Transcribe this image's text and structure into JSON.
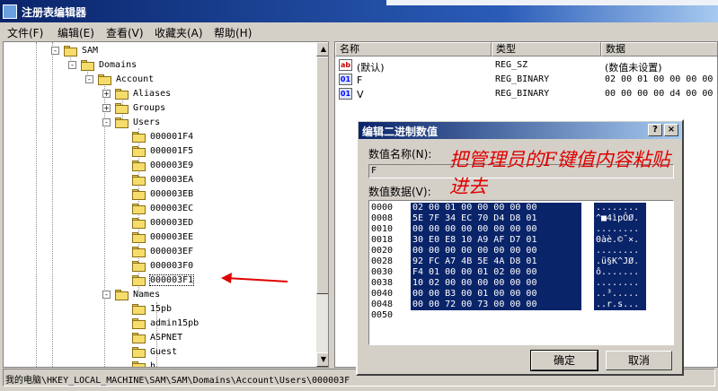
{
  "window": {
    "title": "注册表编辑器"
  },
  "menu": [
    {
      "label": "文件(F)"
    },
    {
      "label": "编辑(E)"
    },
    {
      "label": "查看(V)"
    },
    {
      "label": "收藏夹(A)"
    },
    {
      "label": "帮助(H)"
    }
  ],
  "tree": {
    "nodes": [
      {
        "label": "SAM",
        "expander": "-"
      },
      {
        "label": "Domains",
        "expander": "-"
      },
      {
        "label": "Account",
        "expander": "-"
      },
      {
        "label": "Aliases",
        "expander": "+"
      },
      {
        "label": "Groups",
        "expander": "+"
      },
      {
        "label": "Users",
        "expander": "-"
      },
      {
        "label": "000001F4"
      },
      {
        "label": "000001F5"
      },
      {
        "label": "000003E9"
      },
      {
        "label": "000003EA"
      },
      {
        "label": "000003EB"
      },
      {
        "label": "000003EC"
      },
      {
        "label": "000003ED"
      },
      {
        "label": "000003EE"
      },
      {
        "label": "000003EF"
      },
      {
        "label": "000003F0"
      },
      {
        "label": "000003F1",
        "selected": true
      },
      {
        "label": "Names",
        "expander": "-"
      },
      {
        "label": "15pb"
      },
      {
        "label": "admin15pb"
      },
      {
        "label": "ASPNET"
      },
      {
        "label": "Guest"
      },
      {
        "label": "h..."
      }
    ]
  },
  "list": {
    "columns": [
      "名称",
      "类型",
      "数据"
    ],
    "rows": [
      {
        "icon": "ab",
        "name": "(默认)",
        "type": "REG_SZ",
        "data": "(数值未设置)"
      },
      {
        "icon": "bin",
        "name": "F",
        "type": "REG_BINARY",
        "data": "02 00 01 00 00 00 00 00 5"
      },
      {
        "icon": "bin",
        "name": "V",
        "type": "REG_BINARY",
        "data": "00 00 00 00 d4 00 00 00 0"
      }
    ]
  },
  "statusbar": {
    "path": "我的电脑\\HKEY_LOCAL_MACHINE\\SAM\\SAM\\Domains\\Account\\Users\\000003F"
  },
  "dialog": {
    "title": "编辑二进制数值",
    "help_btn": "?",
    "close_btn": "×",
    "name_label": "数值名称(N):",
    "name_value": "F",
    "data_label": "数值数据(V):",
    "hex_rows": [
      {
        "offset": "0000",
        "bytes": "02 00 01 00 00 00 00 00",
        "ascii": "........"
      },
      {
        "offset": "0008",
        "bytes": "5E 7F 34 EC 70 D4 D8 01",
        "ascii": "^■4ìpÔØ."
      },
      {
        "offset": "0010",
        "bytes": "00 00 00 00 00 00 00 00",
        "ascii": "........"
      },
      {
        "offset": "0018",
        "bytes": "30 E0 E8 10 A9 AF D7 01",
        "ascii": "0àè.©¯×."
      },
      {
        "offset": "0020",
        "bytes": "00 00 00 00 00 00 00 00",
        "ascii": "........"
      },
      {
        "offset": "0028",
        "bytes": "92 FC A7 4B 5E 4A D8 01",
        "ascii": ".ü§K^JØ."
      },
      {
        "offset": "0030",
        "bytes": "F4 01 00 00 01 02 00 00",
        "ascii": "ô......."
      },
      {
        "offset": "0038",
        "bytes": "10 02 00 00 00 00 00 00",
        "ascii": "........"
      },
      {
        "offset": "0040",
        "bytes": "00 00 B3 00 01 00 00 00",
        "ascii": "..³....."
      },
      {
        "offset": "0048",
        "bytes": "00 00 72 00 73 00 00 00",
        "ascii": "..r.s..."
      },
      {
        "offset": "0050",
        "bytes": "",
        "ascii": ""
      }
    ],
    "ok_label": "确定",
    "cancel_label": "取消"
  },
  "annotation": {
    "text": "把管理员的F键值内容粘贴进去",
    "color": "#e00000"
  }
}
